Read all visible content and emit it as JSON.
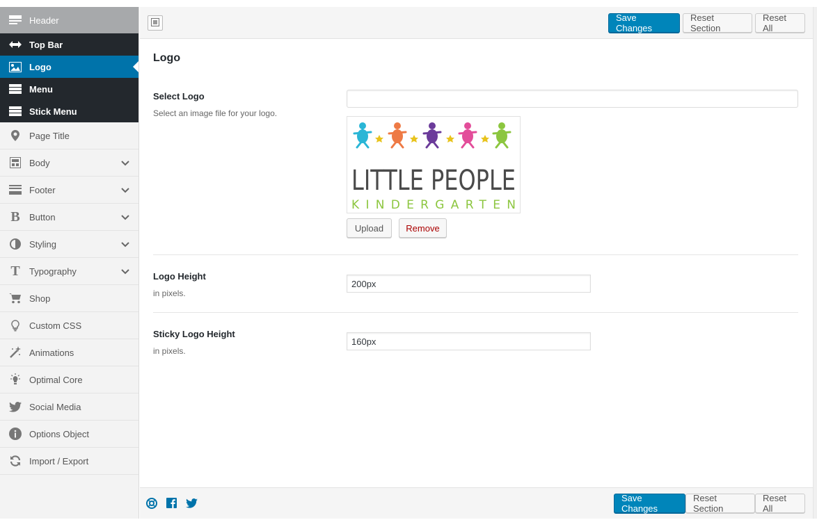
{
  "sidebar": {
    "header": {
      "label": "Header",
      "icon": "header-icon"
    },
    "sub_items": [
      {
        "label": "Top Bar",
        "icon": "arrows-horizontal-icon"
      },
      {
        "label": "Logo",
        "icon": "image-icon",
        "active": true
      },
      {
        "label": "Menu",
        "icon": "menu-icon"
      },
      {
        "label": "Stick Menu",
        "icon": "menu-icon"
      }
    ],
    "items": [
      {
        "label": "Page Title",
        "icon": "location-pin-icon"
      },
      {
        "label": "Body",
        "icon": "layout-icon"
      },
      {
        "label": "Footer",
        "icon": "footer-icon"
      },
      {
        "label": "Button",
        "icon": "bold-b-icon"
      },
      {
        "label": "Styling",
        "icon": "half-circle-icon"
      },
      {
        "label": "Typography",
        "icon": "text-t-icon"
      },
      {
        "label": "Shop",
        "icon": "cart-icon"
      },
      {
        "label": "Custom CSS",
        "icon": "lightbulb-icon"
      },
      {
        "label": "Animations",
        "icon": "magic-wand-icon"
      },
      {
        "label": "Optimal Core",
        "icon": "bulb-rays-icon"
      },
      {
        "label": "Social Media",
        "icon": "twitter-icon"
      },
      {
        "label": "Options Object",
        "icon": "info-icon"
      },
      {
        "label": "Import / Export",
        "icon": "refresh-icon"
      }
    ]
  },
  "toolbar": {
    "save_label": "Save Changes",
    "reset_section_label": "Reset Section",
    "reset_all_label": "Reset All"
  },
  "section": {
    "title": "Logo",
    "fields": {
      "select_logo": {
        "label": "Select Logo",
        "description": "Select an image file for your logo.",
        "value": ""
      },
      "logo_height": {
        "label": "Logo Height",
        "description": "in pixels.",
        "value": "200px"
      },
      "sticky_logo_height": {
        "label": "Sticky Logo Height",
        "description": "in pixels.",
        "value": "160px"
      }
    },
    "upload_label": "Upload",
    "remove_label": "Remove",
    "logo_image": {
      "line1": "LITTLE PEOPLE",
      "line2": "KINDERGARTEN"
    }
  },
  "footer_icons": [
    "support-icon",
    "facebook-icon",
    "twitter-icon"
  ],
  "colors": {
    "primary": "#0085ba",
    "sidebar_dark": "#23282d",
    "active": "#0073aa",
    "remove_text": "#a00"
  }
}
